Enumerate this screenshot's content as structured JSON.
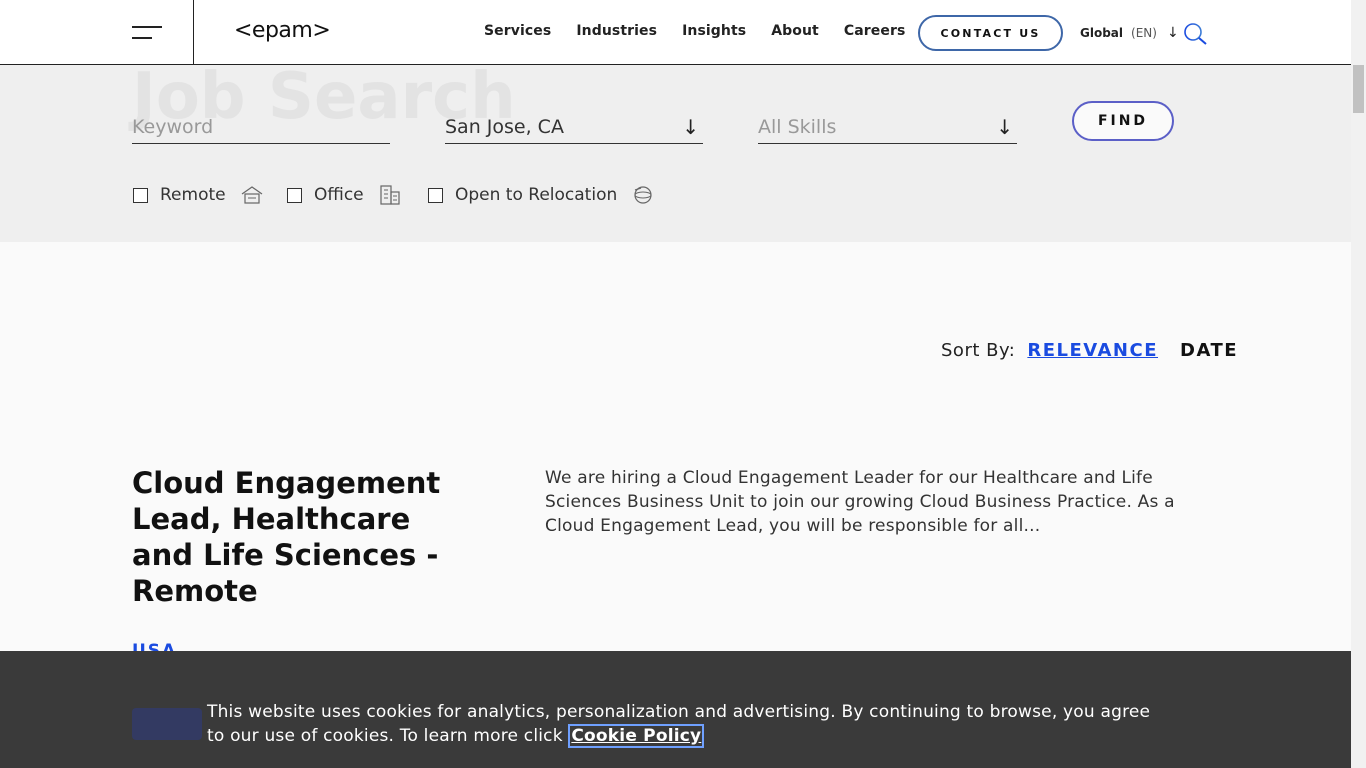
{
  "header": {
    "logo": "<epam>",
    "nav": [
      "Services",
      "Industries",
      "Insights",
      "About",
      "Careers"
    ],
    "contact_label": "CONTACT US",
    "lang_region": "Global",
    "lang_code": "(EN)"
  },
  "filters": {
    "background_ghost": "Job Search",
    "keyword_placeholder": "Keyword",
    "location_value": "San Jose, CA",
    "skills_placeholder": "All Skills",
    "find_label": "FIND",
    "checkboxes": [
      {
        "label": "Remote",
        "icon": "house-icon",
        "checked": false
      },
      {
        "label": "Office",
        "icon": "building-icon",
        "checked": false
      },
      {
        "label": "Open to Relocation",
        "icon": "globe-icon",
        "checked": false
      }
    ]
  },
  "sort": {
    "label": "Sort By:",
    "relevance": "RELEVANCE",
    "date": "DATE"
  },
  "job": {
    "title": "Cloud Engagement Lead, Healthcare and Life Sciences - Remote",
    "description": "We are hiring a Cloud Engagement Leader for our Healthcare and Life Sciences Business Unit to join our growing Cloud Business Practice. As a Cloud Engagement Lead, you will be responsible for all...",
    "country": "USA"
  },
  "cookie": {
    "text": "This website uses cookies for analytics, personalization and advertising. By continuing to browse, you agree to our use of cookies. To learn more click ",
    "link": "Cookie Policy"
  },
  "colors": {
    "accent_blue": "#1a4be0",
    "cookie_bg": "#3a3a3a",
    "filter_bg": "#efefef"
  }
}
